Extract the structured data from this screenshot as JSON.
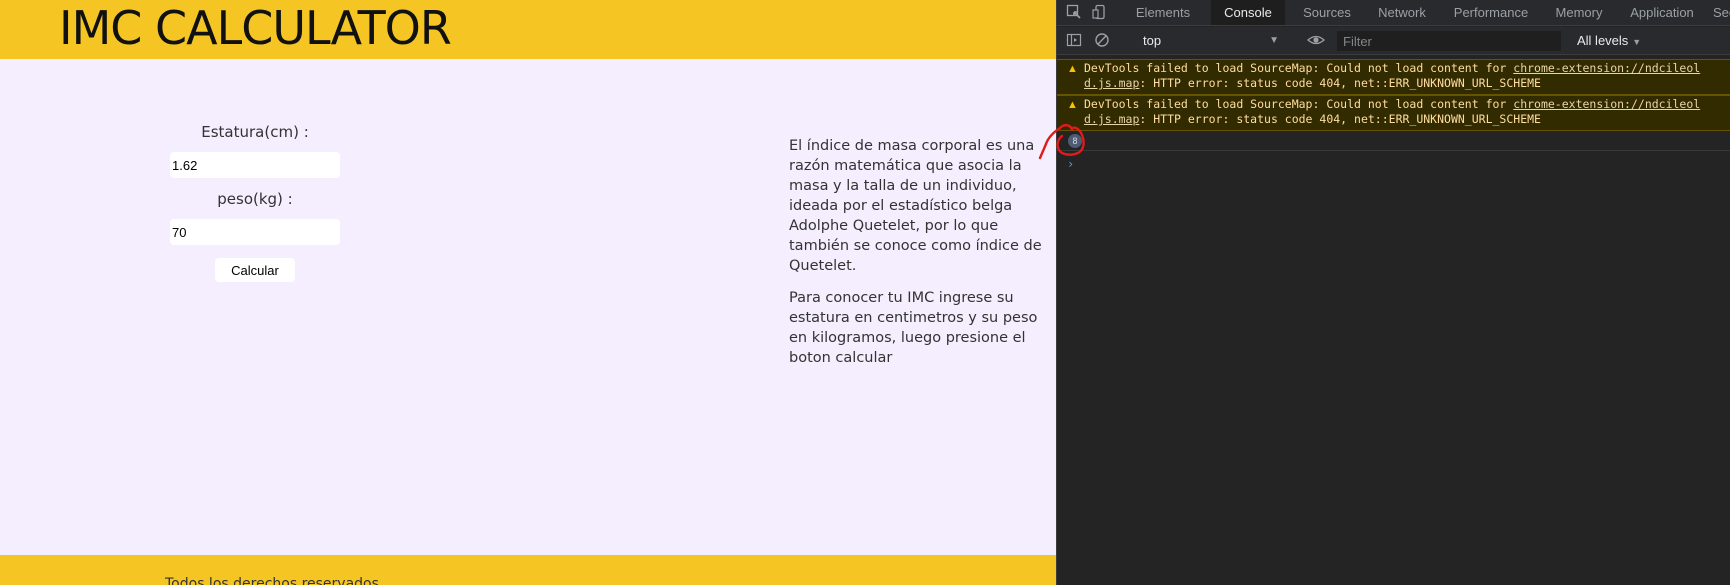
{
  "page": {
    "title": "IMC CALCULATOR",
    "form": {
      "height_label": "Estatura(cm) :",
      "height_value": "1.62",
      "weight_label": "peso(kg) :",
      "weight_value": "70",
      "calculate_label": "Calcular"
    },
    "info": {
      "paragraph1": "El índice de masa corporal es una razón matemática que asocia la masa y la talla de un individuo, ideada por el estadístico belga Adolphe Quetelet, por lo que también se conoce como índice de Quetelet.",
      "paragraph2": "Para conocer tu IMC ingrese su estatura en centimetros y su peso en kilogramos, luego presione el boton calcular"
    },
    "footer": "Todos los derechos reservados",
    "colors": {
      "accent": "#f5c623",
      "background": "#f4eefe"
    }
  },
  "devtools": {
    "tabs": [
      {
        "label": "Elements"
      },
      {
        "label": "Console"
      },
      {
        "label": "Sources"
      },
      {
        "label": "Network"
      },
      {
        "label": "Performance"
      },
      {
        "label": "Memory"
      },
      {
        "label": "Application"
      },
      {
        "label": "Sec"
      }
    ],
    "active_tab": "Console",
    "toolbar": {
      "context": "top",
      "filter_placeholder": "Filter",
      "levels": "All levels"
    },
    "messages": [
      {
        "prefix": "DevTools failed to load SourceMap: Could not load content for ",
        "link": "chrome-extension://ndcileol",
        "link_cont": "d.js.map",
        "suffix": ": HTTP error: status code 404, net::ERR_UNKNOWN_URL_SCHEME"
      },
      {
        "prefix": "DevTools failed to load SourceMap: Could not load content for ",
        "link": "chrome-extension://ndcileol",
        "link_cont": "d.js.map",
        "suffix": ": HTTP error: status code 404, net::ERR_UNKNOWN_URL_SCHEME"
      }
    ],
    "issue_count": "8",
    "prompt_symbol": "›"
  }
}
